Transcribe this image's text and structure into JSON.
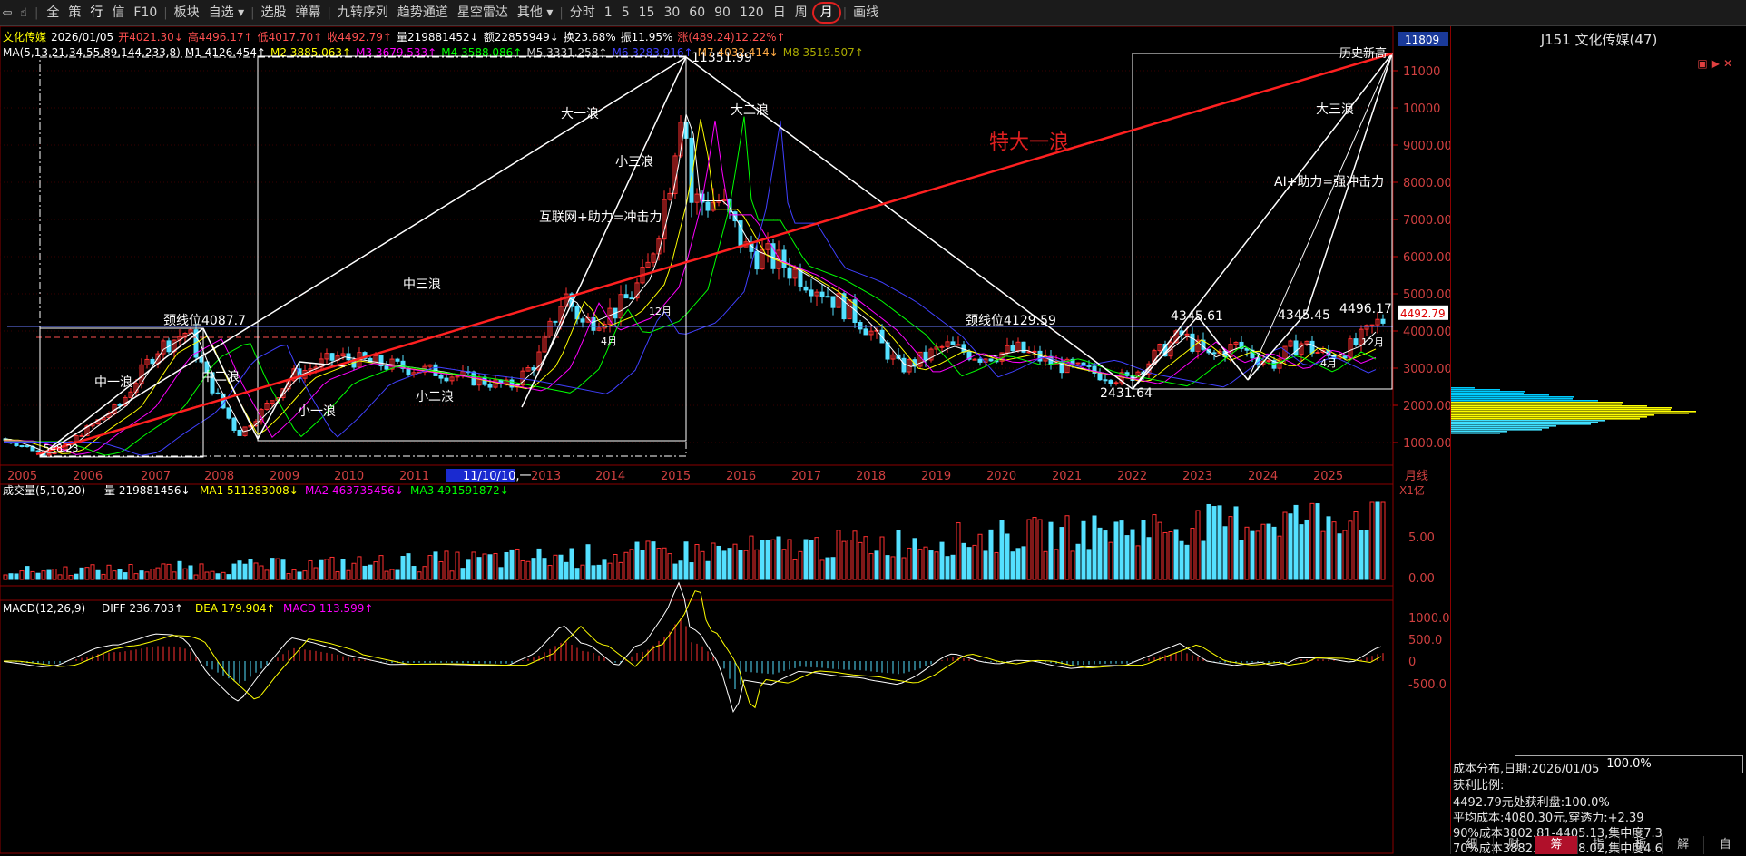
{
  "toolbar": {
    "items": [
      {
        "label": "全"
      },
      {
        "label": "策"
      },
      {
        "label": "行",
        "active": true
      },
      {
        "label": "信"
      },
      {
        "label": "F10"
      },
      {
        "label": "板块"
      },
      {
        "label": "自选 ▾"
      },
      {
        "label": "选股"
      },
      {
        "label": "弹幕"
      },
      {
        "label": "九转序列"
      },
      {
        "label": "趋势通道"
      },
      {
        "label": "星空雷达"
      },
      {
        "label": "其他 ▾"
      },
      {
        "label": "分时"
      },
      {
        "label": "1"
      },
      {
        "label": "5"
      },
      {
        "label": "15"
      },
      {
        "label": "30"
      },
      {
        "label": "60"
      },
      {
        "label": "90"
      },
      {
        "label": "120"
      },
      {
        "label": "日"
      },
      {
        "label": "周"
      },
      {
        "label": "月",
        "month": true
      },
      {
        "label": "画线"
      }
    ]
  },
  "header": {
    "name": "文化传媒",
    "date": "2026/01/05",
    "open": "开4021.30↓",
    "high": "高4496.17↑",
    "low": "低4017.70↑",
    "close": "收4492.79↑",
    "vol": "量219881452↓",
    "amount": "额22855949↓",
    "turnover": "换23.68%",
    "amplitude": "振11.95%",
    "change": "涨(489.24)12.22%↑"
  },
  "ma_line": {
    "label": "MA(5,13,21,34,55,89,144,233,8)",
    "items": [
      {
        "text": "M1 4126.454↑",
        "color": "#ffffff"
      },
      {
        "text": "M2 3885.063↑",
        "color": "#ffff00"
      },
      {
        "text": "M3 3679.533↑",
        "color": "#ff00ff"
      },
      {
        "text": "M4 3588.086↑",
        "color": "#00ff00"
      },
      {
        "text": "M5 3331.258↑",
        "color": "#d0d0d0"
      },
      {
        "text": "M6 3283.916↑",
        "color": "#4040ff"
      },
      {
        "text": "M7 4032.414↓",
        "color": "#ffaa44"
      },
      {
        "text": "M8 3519.507↑",
        "color": "#aaaa00"
      }
    ]
  },
  "price_axis": {
    "top_badge": "11809",
    "current": "4492.79",
    "ticks": [
      "11000",
      "10000",
      "9000.00",
      "8000.00",
      "7000.00",
      "6000.00",
      "5000.00",
      "4000.00",
      "3000.00",
      "2000.00",
      "1000.00"
    ]
  },
  "years": [
    "2005",
    "2006",
    "2007",
    "2008",
    "2009",
    "2010",
    "2011",
    "11/10/10,一",
    "2013",
    "2014",
    "2015",
    "2016",
    "2017",
    "2018",
    "2019",
    "2020",
    "2021",
    "2022",
    "2023",
    "2024",
    "2025"
  ],
  "period_label": "月线",
  "annotations": {
    "peak": "11351.99",
    "big1": "大一浪",
    "big2": "大二浪",
    "big3": "大三浪",
    "huge": "特大一浪",
    "small3": "小三浪",
    "internet": "互联网+助力=冲击力",
    "mid3": "中三浪",
    "neck1": "颈线位4087.7",
    "mid1": "中一浪",
    "mid2": "中二浪",
    "small1": "小一浪",
    "small2": "小二浪",
    "low1": "548.23",
    "m12a": "12月",
    "m4a": "4月",
    "neck2": "颈线位4129.59",
    "low2": "2431.64",
    "p4345a": "4345.61",
    "p4345b": "4345.45",
    "p4496": "4496.17",
    "record": "历史新高",
    "ai": "AI+助力=强冲击力",
    "m12b": "12月",
    "m4b": "4月"
  },
  "volume": {
    "label": "成交量(5,10,20)",
    "vol": "量 219881456↓",
    "ma1": "MA1 511283008↓",
    "ma2": "MA2 463735456↓",
    "ma3": "MA3 491591872↓",
    "unit": "X1亿",
    "ticks": [
      "5.00",
      "0.00"
    ]
  },
  "macd": {
    "label": "MACD(12,26,9)",
    "diff": "DIFF 236.703↑",
    "dea": "DEA 179.904↑",
    "macd": "MACD 113.599↑",
    "ticks": [
      "1000.0",
      "500.0",
      "0",
      "-500.0"
    ]
  },
  "side": {
    "title": "J151 文化传媒(47)",
    "cost_title": "成本分布,日期:2026/01/05",
    "profit_label": "获利比例:",
    "profit_value": "100.0%",
    "line1": "4492.79元处获利盘:100.0%",
    "line2": "平均成本:4080.30元,穿透力:+2.39",
    "line3": "90%成本3802.81-4405.13,集中度7.3",
    "line4": "70%成本3882.08-4258.02,集中度4.6",
    "tabs": [
      "细",
      "财",
      "筹",
      "指",
      "板",
      "解",
      "自"
    ]
  }
}
